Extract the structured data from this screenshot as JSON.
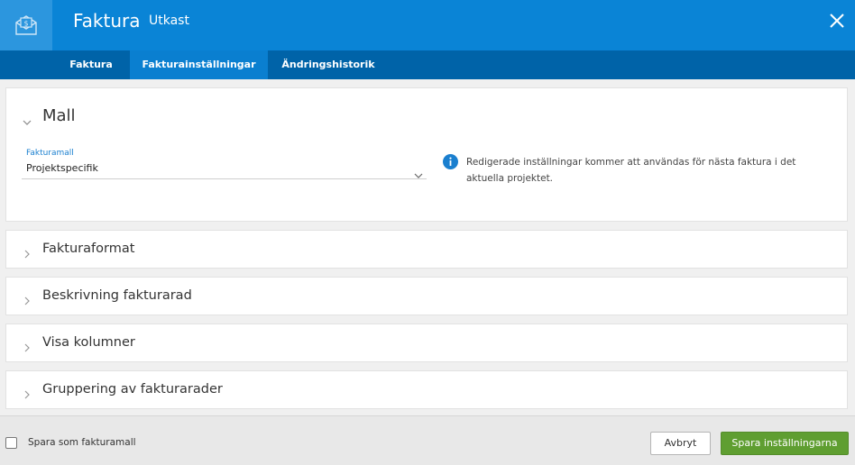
{
  "header": {
    "title": "Faktura",
    "subtitle": "Utkast",
    "icon": "invoice-envelope-icon",
    "close_icon": "close-icon"
  },
  "tabs": [
    {
      "label": "Faktura",
      "active": false
    },
    {
      "label": "Fakturainställningar",
      "active": true
    },
    {
      "label": "Ändringshistorik",
      "active": false
    }
  ],
  "mall": {
    "title": "Mall",
    "expanded": true,
    "field_label": "Fakturamall",
    "field_value": "Projektspecifik",
    "info_text": "Redigerade inställningar kommer att användas för nästa faktura i det aktuella projektet."
  },
  "sections": [
    {
      "title": "Fakturaformat"
    },
    {
      "title": "Beskrivning fakturarad"
    },
    {
      "title": "Visa kolumner"
    },
    {
      "title": "Gruppering av fakturarader"
    }
  ],
  "footer": {
    "checkbox_label": "Spara som fakturamall",
    "checkbox_checked": false,
    "cancel_label": "Avbryt",
    "save_label": "Spara inställningarna"
  },
  "colors": {
    "header_bg": "#0a84d6",
    "tabbar_bg": "#0063a8",
    "accent": "#1a7fcf",
    "save_button": "#5f9e31"
  }
}
